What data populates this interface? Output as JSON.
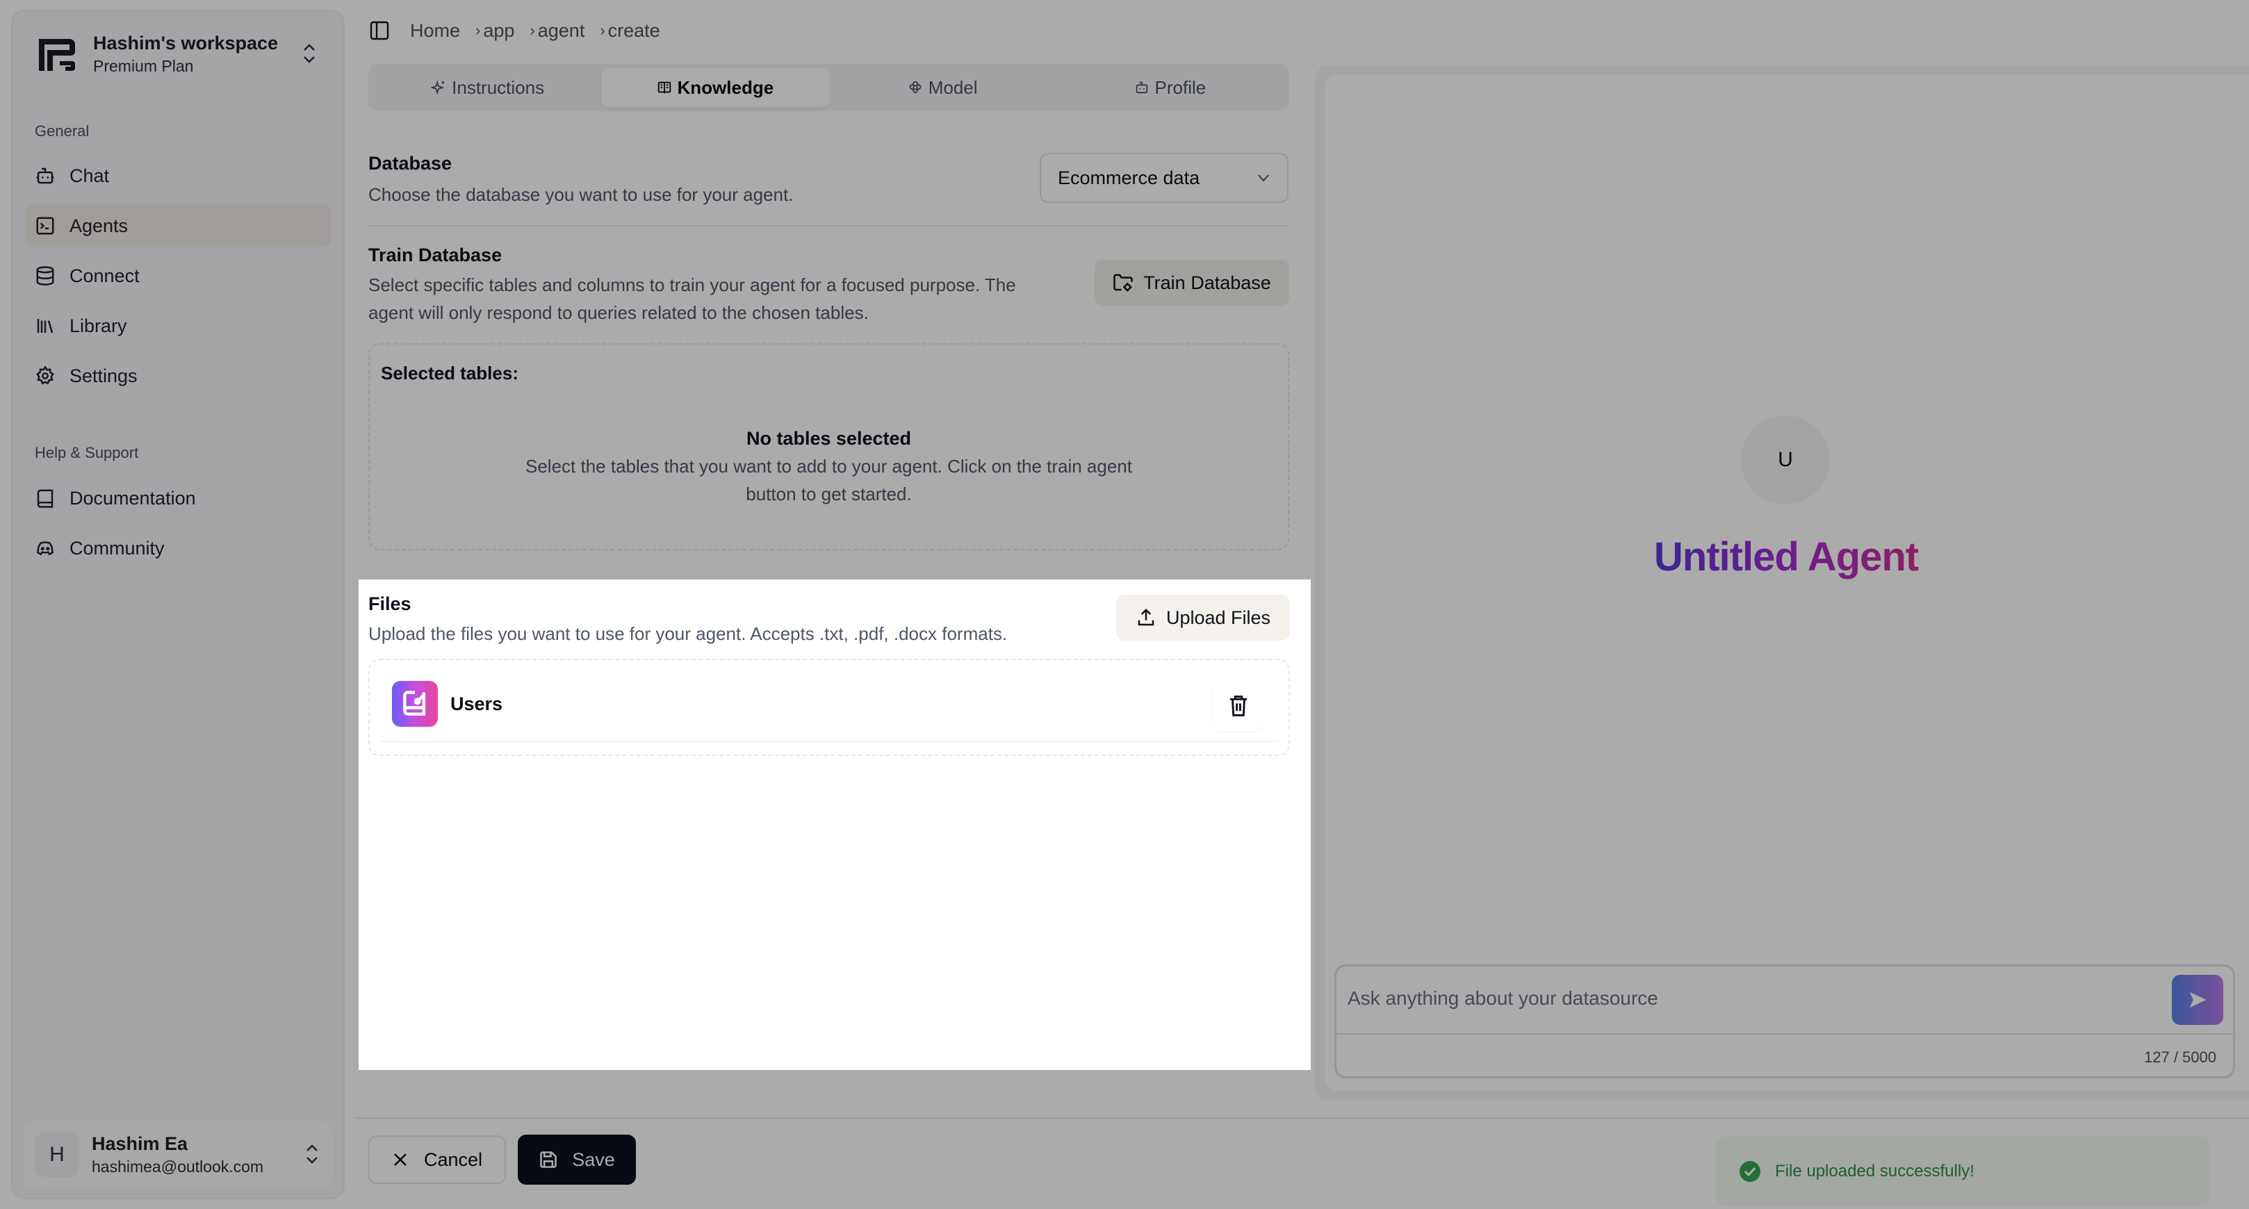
{
  "workspace": {
    "name": "Hashim's workspace",
    "plan": "Premium Plan"
  },
  "sidebar": {
    "general_label": "General",
    "general_items": [
      {
        "label": "Chat",
        "icon": "bot-icon"
      },
      {
        "label": "Agents",
        "icon": "terminal-square-icon",
        "active": true
      },
      {
        "label": "Connect",
        "icon": "database-icon"
      },
      {
        "label": "Library",
        "icon": "library-icon"
      },
      {
        "label": "Settings",
        "icon": "gear-icon"
      }
    ],
    "help_label": "Help & Support",
    "help_items": [
      {
        "label": "Documentation",
        "icon": "book-icon"
      },
      {
        "label": "Community",
        "icon": "discord-icon"
      }
    ]
  },
  "user": {
    "initial": "H",
    "name": "Hashim Ea",
    "email": "hashimea@outlook.com"
  },
  "breadcrumb": [
    "Home",
    "app",
    "agent",
    "create"
  ],
  "tabs": [
    {
      "label": "Instructions",
      "icon": "sparkles-icon"
    },
    {
      "label": "Knowledge",
      "icon": "book-open-icon",
      "active": true
    },
    {
      "label": "Model",
      "icon": "model-icon"
    },
    {
      "label": "Profile",
      "icon": "bot-icon"
    }
  ],
  "database": {
    "title": "Database",
    "description": "Choose the database you want to use for your agent.",
    "selected": "Ecommerce data"
  },
  "train": {
    "title": "Train Database",
    "description_line1": "Select specific tables and columns to train your agent for a focused purpose. The",
    "description_line2": "agent will only respond to queries related to the chosen tables.",
    "button": "Train Database"
  },
  "selected_tables": {
    "label": "Selected tables:",
    "empty_title": "No tables selected",
    "empty_line1": "Select the tables that you want to add to your agent. Click on the train agent",
    "empty_line2": "button to get started."
  },
  "files": {
    "title": "Files",
    "description": "Upload the files you want to use for your agent. Accepts .txt, .pdf, .docx formats.",
    "upload_button": "Upload Files",
    "items": [
      {
        "name": "Users"
      }
    ]
  },
  "preview": {
    "avatar_initial": "U",
    "agent_name": "Untitled Agent",
    "input_placeholder": "Ask anything about your datasource",
    "char_count": "127 / 5000"
  },
  "footer": {
    "cancel": "Cancel",
    "save": "Save"
  },
  "toast": {
    "message": "File uploaded successfully!",
    "status_color": "#2e8a45"
  }
}
